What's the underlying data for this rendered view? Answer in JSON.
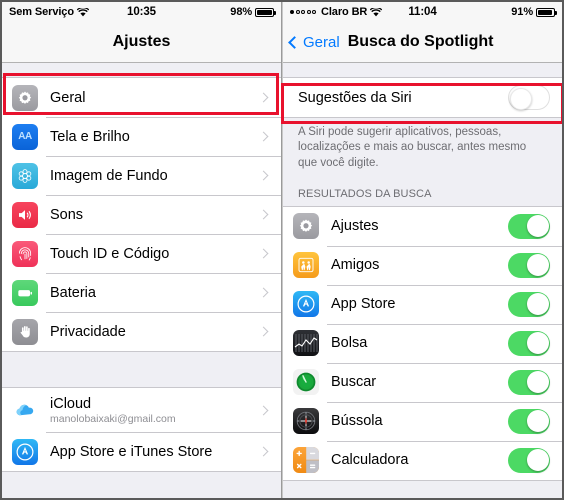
{
  "left_panel": {
    "status_bar": {
      "carrier": "Sem Serviço",
      "wifi_icon": "wifi-icon",
      "time": "10:35",
      "battery_percent": "98%",
      "battery_icon": "battery-icon"
    },
    "nav": {
      "title": "Ajustes"
    },
    "groups": [
      {
        "rows": [
          {
            "label": "Geral",
            "icon": "gear-icon",
            "accessory": "chevron-right-icon",
            "highlighted": true
          },
          {
            "label": "Tela e Brilho",
            "icon": "display-brightness-icon",
            "accessory": "chevron-right-icon"
          },
          {
            "label": "Imagem de Fundo",
            "icon": "wallpaper-icon",
            "accessory": "chevron-right-icon"
          },
          {
            "label": "Sons",
            "icon": "speaker-icon",
            "accessory": "chevron-right-icon"
          },
          {
            "label": "Touch ID e Código",
            "icon": "fingerprint-icon",
            "accessory": "chevron-right-icon"
          },
          {
            "label": "Bateria",
            "icon": "battery-icon",
            "accessory": "chevron-right-icon"
          },
          {
            "label": "Privacidade",
            "icon": "hand-icon",
            "accessory": "chevron-right-icon"
          }
        ]
      },
      {
        "rows": [
          {
            "label": "iCloud",
            "sublabel": "manolobaixaki@gmail.com",
            "icon": "icloud-icon",
            "accessory": "chevron-right-icon"
          },
          {
            "label": "App Store e iTunes Store",
            "icon": "app-store-icon",
            "accessory": "chevron-right-icon"
          }
        ]
      }
    ]
  },
  "right_panel": {
    "status_bar": {
      "signal_dots_filled": 1,
      "signal_dots_total": 5,
      "carrier": "Claro BR",
      "wifi_icon": "wifi-icon",
      "time": "11:04",
      "battery_percent": "91%",
      "battery_icon": "battery-icon"
    },
    "nav": {
      "back_label": "Geral",
      "back_icon": "chevron-left-icon",
      "title": "Busca do Spotlight"
    },
    "siri_row": {
      "label": "Sugestões da Siri",
      "toggle": "off",
      "highlighted": true
    },
    "footer_text": "A Siri pode sugerir aplicativos, pessoas, localizações e mais ao buscar, antes mesmo que você digite.",
    "section_header": "RESULTADOS DA BUSCA",
    "results": [
      {
        "label": "Ajustes",
        "icon": "gear-icon",
        "toggle": "on"
      },
      {
        "label": "Amigos",
        "icon": "friends-icon",
        "toggle": "on"
      },
      {
        "label": "App Store",
        "icon": "app-store-icon",
        "toggle": "on"
      },
      {
        "label": "Bolsa",
        "icon": "stocks-icon",
        "toggle": "on"
      },
      {
        "label": "Buscar",
        "icon": "find-my-friends-icon",
        "toggle": "on"
      },
      {
        "label": "Bússola",
        "icon": "compass-icon",
        "toggle": "on"
      },
      {
        "label": "Calculadora",
        "icon": "calculator-icon",
        "toggle": "on"
      }
    ]
  },
  "colors": {
    "toggle_on": "#4cd964",
    "accent_blue": "#037aff",
    "highlight_red": "#e8112d",
    "group_bg": "#ffffff",
    "page_bg": "#efeff4"
  }
}
